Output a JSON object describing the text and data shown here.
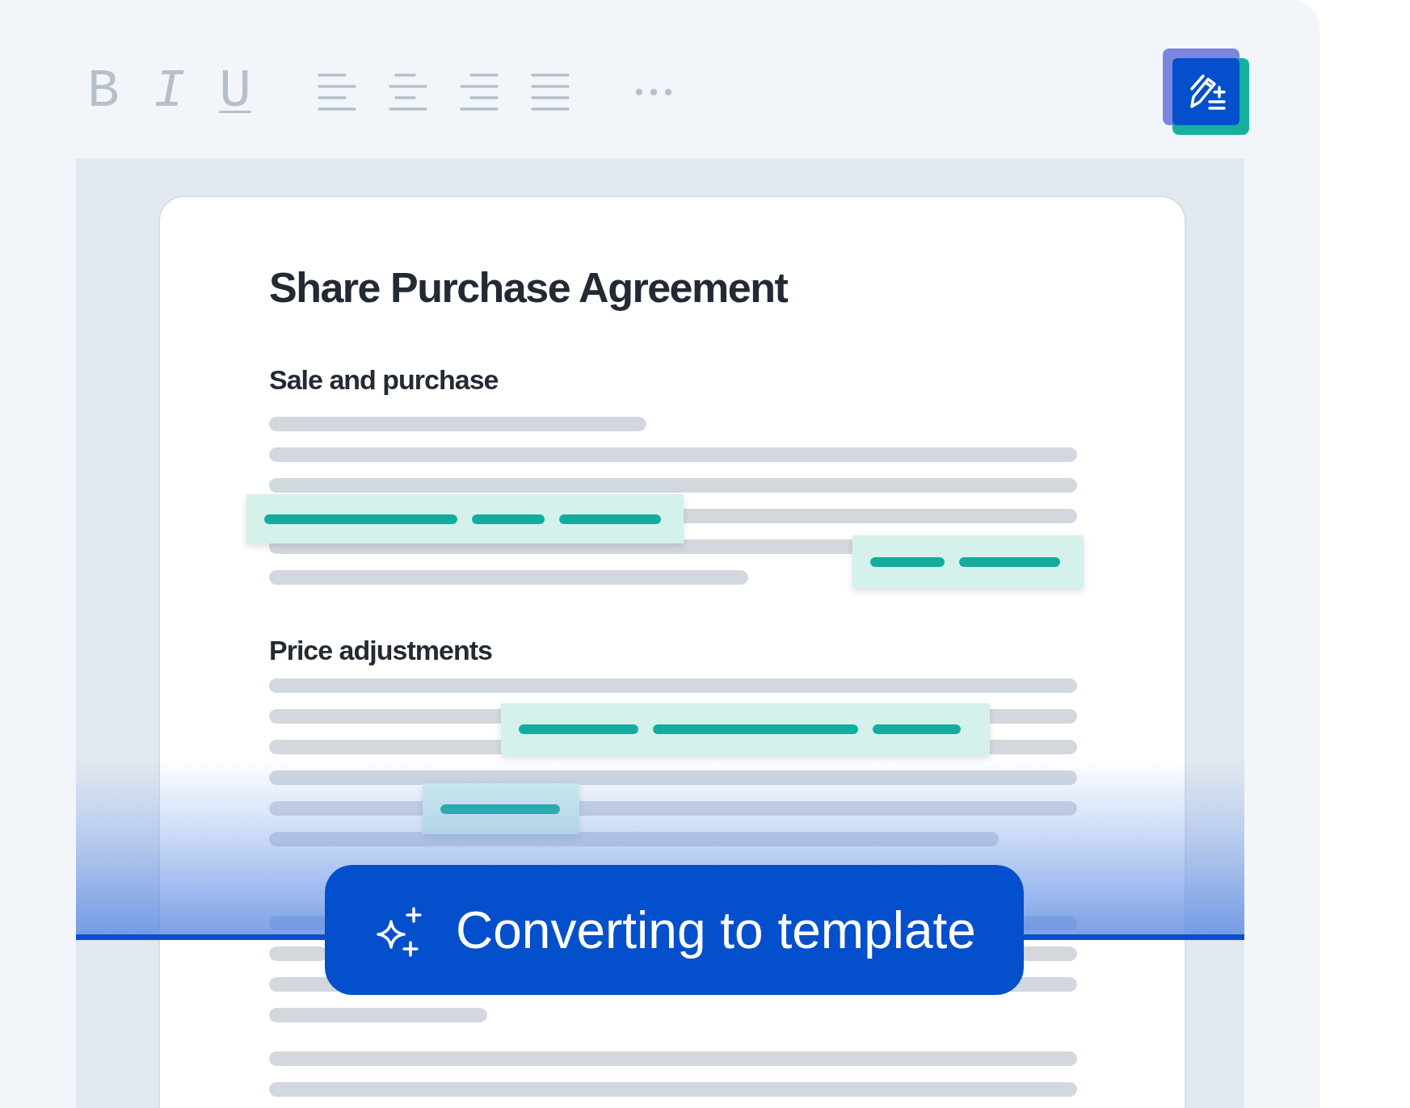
{
  "toolbar": {
    "items": [
      {
        "kind": "bold",
        "label": "B"
      },
      {
        "kind": "italic",
        "label": "I"
      },
      {
        "kind": "underline",
        "label": "U"
      },
      {
        "kind": "align-left"
      },
      {
        "kind": "align-center"
      },
      {
        "kind": "align-right"
      },
      {
        "kind": "justify"
      },
      {
        "kind": "more"
      }
    ]
  },
  "document": {
    "title": "Share Purchase Agreement",
    "sections": [
      {
        "heading": "Sale and purchase"
      },
      {
        "heading": "Price adjustments"
      }
    ]
  },
  "status_banner": {
    "label": "Converting to template"
  }
}
